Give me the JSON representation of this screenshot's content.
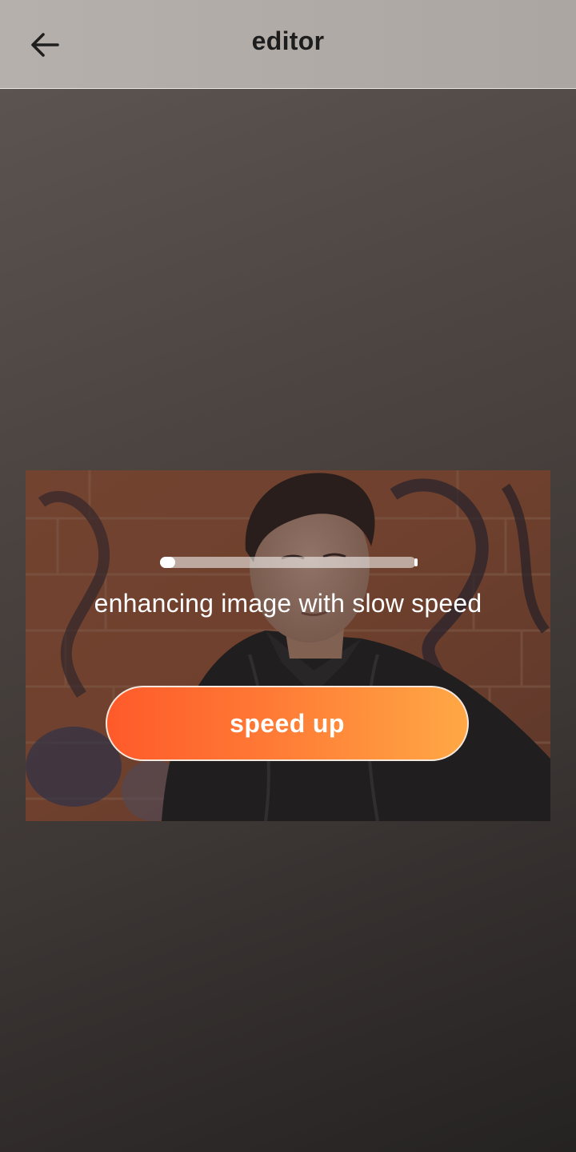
{
  "app_bar": {
    "title": "editor",
    "back_icon": "arrow-left-icon"
  },
  "processing": {
    "progress_fraction": 0.06,
    "status_text": "enhancing image with slow speed",
    "speed_up_label": "speed up"
  },
  "colors": {
    "app_bar": "#b0aaa6",
    "background_top": "#5f5753",
    "background_bottom": "#252222",
    "button_gradient_start": "#ff5a2a",
    "button_gradient_end": "#ffa845",
    "title_text": "#1d1d1d",
    "status_text": "#ffffff"
  }
}
